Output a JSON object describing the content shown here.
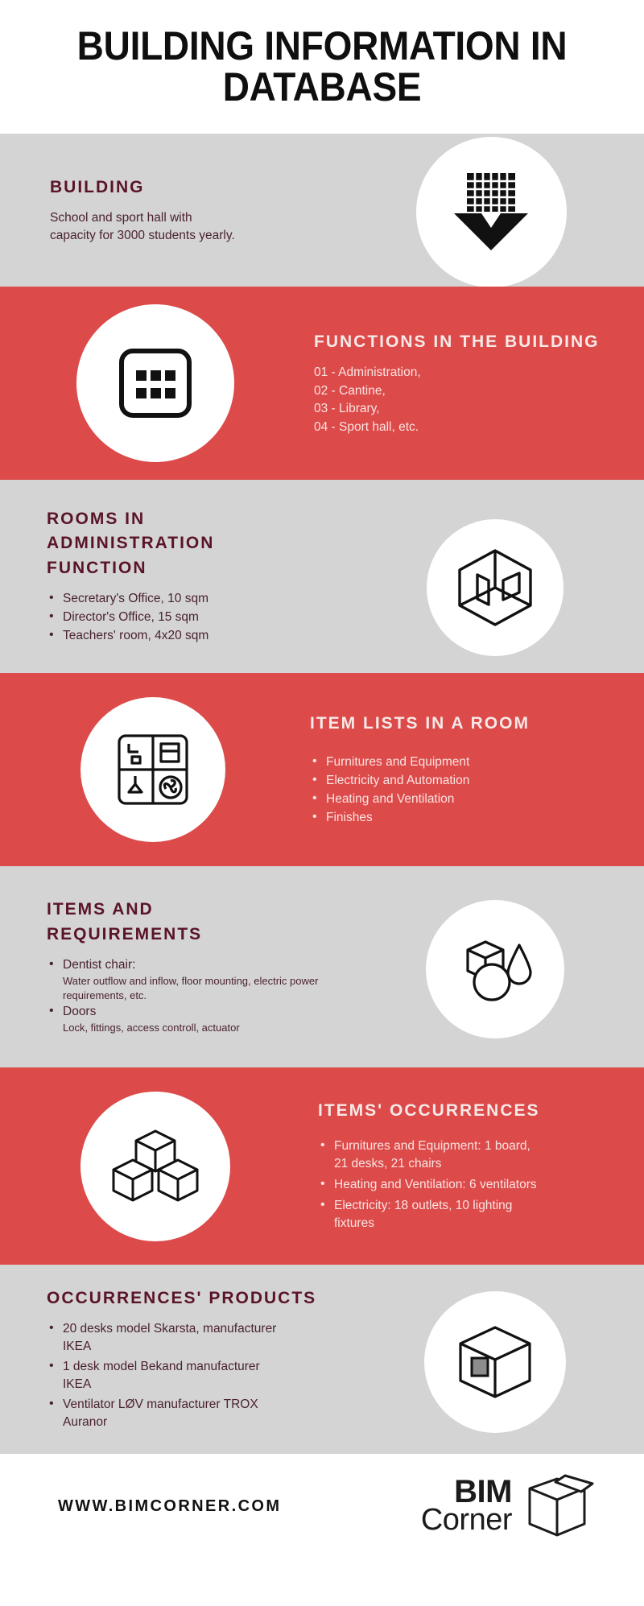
{
  "header": {
    "title": "BUILDING INFORMATION IN DATABASE"
  },
  "colors": {
    "red": "#dc4a4a",
    "gray": "#d4d4d4",
    "maroon": "#5a1428",
    "body_gray": "#4a2230",
    "light_text": "#fae4e1",
    "white": "#ffffff",
    "black": "#111111"
  },
  "sections": [
    {
      "id": "building",
      "theme": "gray",
      "icon": "building-arrow-icon",
      "icon_side": "right",
      "title": "BUILDING",
      "paragraph": "School and sport hall with capacity for 3000 students yearly."
    },
    {
      "id": "functions",
      "theme": "red",
      "icon": "grid-panel-icon",
      "icon_side": "left",
      "title": "FUNCTIONS IN THE BUILDING",
      "lines": [
        "01 - Administration,",
        "02 - Cantine,",
        "03 - Library,",
        "04 - Sport hall, etc."
      ]
    },
    {
      "id": "rooms",
      "theme": "gray",
      "icon": "isometric-room-icon",
      "icon_side": "right",
      "title": "ROOMS IN ADMINISTRATION FUNCTION",
      "bullets": [
        {
          "text": "Secretary's Office, 10 sqm"
        },
        {
          "text": "Director's Office, 15 sqm"
        },
        {
          "text": "Teachers' room, 4x20 sqm"
        }
      ]
    },
    {
      "id": "item-lists",
      "theme": "red",
      "icon": "room-equipment-icon",
      "icon_side": "left",
      "title": "ITEM LISTS IN A ROOM",
      "bullets": [
        {
          "text": "Furnitures and Equipment"
        },
        {
          "text": "Electricity and Automation"
        },
        {
          "text": "Heating and Ventilation"
        },
        {
          "text": "Finishes"
        }
      ]
    },
    {
      "id": "items-requirements",
      "theme": "gray",
      "icon": "shapes-icon",
      "icon_side": "right",
      "title": "ITEMS AND REQUIREMENTS",
      "bullets": [
        {
          "text": "Dentist chair:",
          "sub": "Water outflow and inflow, floor mounting, electric power requirements, etc."
        },
        {
          "text": "Doors",
          "sub": "Lock, fittings, access controll, actuator"
        }
      ]
    },
    {
      "id": "occurrences",
      "theme": "red",
      "icon": "stacked-cubes-icon",
      "icon_side": "left",
      "title": "ITEMS' OCCURRENCES",
      "bullets": [
        {
          "text": "Furnitures and Equipment: 1 board, 21 desks, 21 chairs"
        },
        {
          "text": "Heating and Ventilation: 6 ventilators"
        },
        {
          "text": "Electricity: 18 outlets, 10 lighting fixtures"
        }
      ]
    },
    {
      "id": "products",
      "theme": "gray",
      "icon": "product-box-icon",
      "icon_side": "right",
      "title": "OCCURRENCES' PRODUCTS",
      "bullets": [
        {
          "text": "20 desks model Skarsta, manufacturer IKEA"
        },
        {
          "text": "1 desk model Bekand manufacturer IKEA"
        },
        {
          "text": "Ventilator LØV manufacturer TROX Auranor"
        }
      ]
    }
  ],
  "footer": {
    "url": "WWW.BIMCORNER.COM",
    "logo_top": "BIM",
    "logo_bottom": "Corner",
    "logo_icon": "open-box-icon"
  }
}
